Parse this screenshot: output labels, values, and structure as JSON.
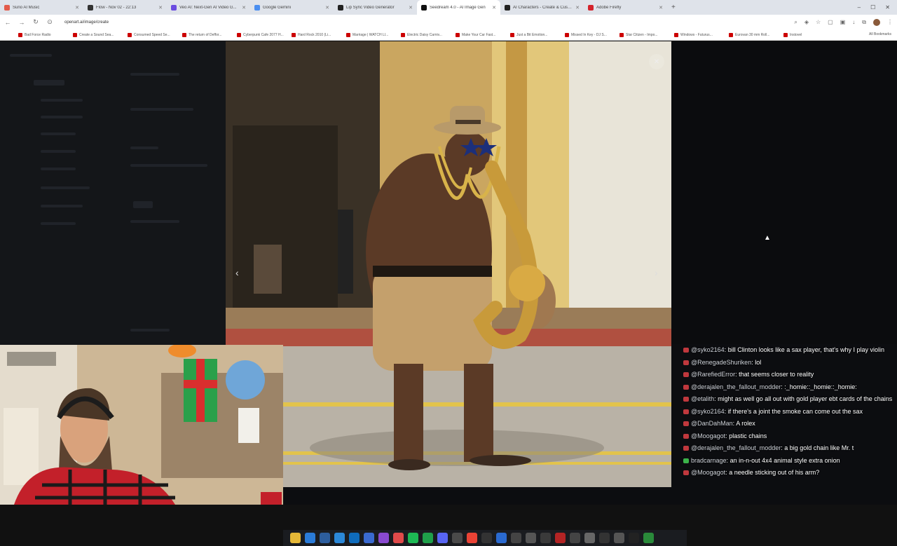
{
  "browser": {
    "tabs": [
      {
        "label": "Suno AI Music",
        "color": "#e35b4a"
      },
      {
        "label": "Flow - Nov 02 - 22:13",
        "color": "#333333"
      },
      {
        "label": "Veo AI: Next-Gen AI Video G...",
        "color": "#6b4ce0"
      },
      {
        "label": "Google Gemini",
        "color": "#4a8ef0"
      },
      {
        "label": "Lip Sync Video Generator",
        "color": "#222222"
      },
      {
        "label": "Seedream 4.0 - AI Image Gen",
        "color": "#111111",
        "active": true
      },
      {
        "label": "AI Characters - Create & Custo...",
        "color": "#222222"
      },
      {
        "label": "Adobe Firefly",
        "color": "#d4232b"
      }
    ],
    "new_tab": "+",
    "url": "openart.ai/image/create",
    "bookmarks": [
      "Bad Force Radio",
      "Create a Sound Sea...",
      "Consumed Speed Se...",
      "The return of Deffor...",
      "Cyberpunk Cafe 2077 H...",
      "Hard Rock 2010 (Li...",
      "Marriage | WATCH LI...",
      "Electric Daisy Carniv...",
      "Make Your Car Fast...",
      "Just a Bit Emotion...",
      "Missed In Key - DJ S...",
      "Star Citizen - Impo...",
      "Windows - Futurus...",
      "Eurovan 30 mm Roll...",
      "Instovel"
    ],
    "all_bookmarks": "All Bookmarks"
  },
  "viewer": {
    "prev_label": "‹",
    "next_label": "›",
    "close_label": "✕"
  },
  "chat": [
    {
      "user": "@syko2164",
      "text": "bill Clinton looks like a sax player, that's why I play violin",
      "badge": "red"
    },
    {
      "user": "@RenegadeShuriken",
      "text": "lol",
      "badge": "red"
    },
    {
      "user": "@RarefiedError",
      "text": "that seems closer to reality",
      "badge": "red"
    },
    {
      "user": "@derajalen_the_fallout_modder",
      "text": ":_homie::_homie::_homie:",
      "badge": "red"
    },
    {
      "user": "@etalith",
      "text": "might as well go all out with gold player ebt cards of the chains",
      "badge": "red"
    },
    {
      "user": "@syko2164",
      "text": "if there's a joint the smoke can come out the sax",
      "badge": "red"
    },
    {
      "user": "@DanDahMan",
      "text": "A rolex",
      "badge": "red"
    },
    {
      "user": "@Moogagot",
      "text": "plastic chains",
      "badge": "red"
    },
    {
      "user": "@derajalen_the_fallout_modder",
      "text": "a big gold chain like Mr. t",
      "badge": "red"
    },
    {
      "user": "bradcarnage",
      "text": "an in-n-out 4x4 animal style extra onion",
      "badge": "green"
    },
    {
      "user": "@Moogagot",
      "text": "a needle sticking out of his arm?",
      "badge": "red"
    }
  ],
  "colors": {
    "chat_badge_red": "#c0383d",
    "chat_badge_green": "#3bb34a"
  }
}
